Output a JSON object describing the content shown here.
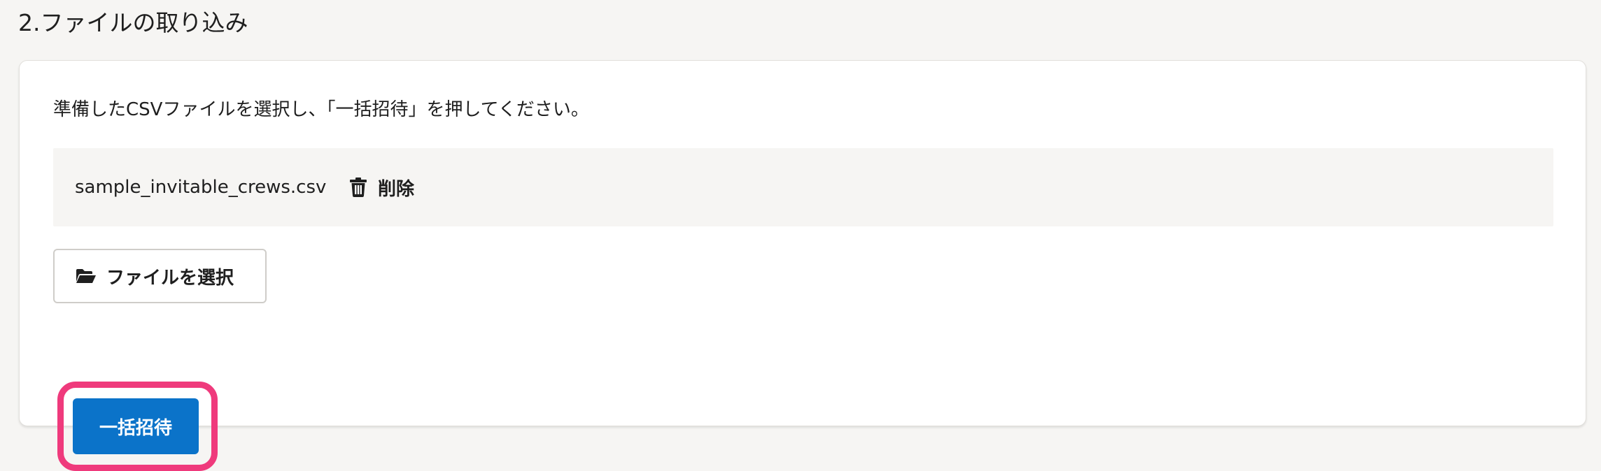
{
  "section": {
    "title": "2.ファイルの取り込み"
  },
  "card": {
    "instructions": "準備したCSVファイルを選択し、「一括招待」を押してください。",
    "file": {
      "name": "sample_invitable_crews.csv",
      "delete_label": "削除",
      "delete_icon": "trash-icon"
    },
    "select_button": {
      "label": "ファイルを選択",
      "icon": "folder-open-icon"
    },
    "invite_button": {
      "label": "一括招待"
    }
  },
  "colors": {
    "page_background": "#f6f5f3",
    "card_background": "#ffffff",
    "file_row_background": "#f6f5f3",
    "primary_button": "#0b73c9",
    "highlight": "#ef3a7c",
    "text": "#1f1f1f"
  }
}
